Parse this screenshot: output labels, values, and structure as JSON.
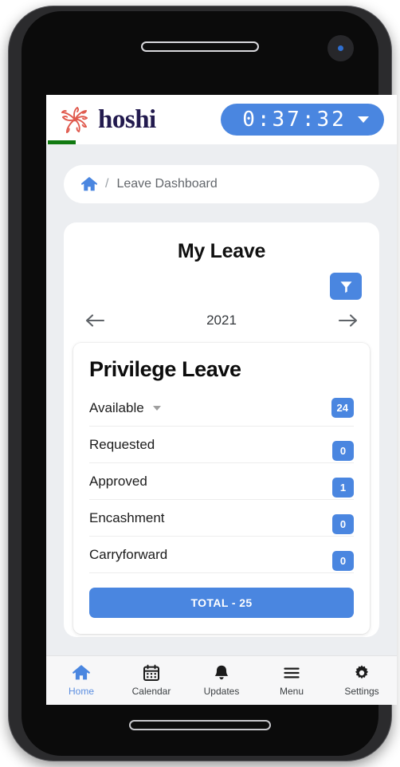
{
  "header": {
    "brand_name": "hoshi",
    "logo_icon": "hoshi-starburst-logo",
    "timer_value": "0:37:32",
    "timer_caret_icon": "chevron-down-icon",
    "accent_color": "#4a86e0",
    "progress_color": "#117a11",
    "brand_text_color": "#221a4e"
  },
  "breadcrumb": {
    "home_icon": "home-icon",
    "separator": "/",
    "current": "Leave Dashboard"
  },
  "leave_panel": {
    "title": "My Leave",
    "filter_icon": "filter-funnel-icon",
    "prev_icon": "arrow-left-icon",
    "next_icon": "arrow-right-icon",
    "year": "2021",
    "leave_type": "Privilege Leave",
    "rows": [
      {
        "label": "Available",
        "value": "24",
        "has_dropdown": true
      },
      {
        "label": "Requested",
        "value": "0",
        "has_dropdown": false
      },
      {
        "label": "Approved",
        "value": "1",
        "has_dropdown": false
      },
      {
        "label": "Encashment",
        "value": "0",
        "has_dropdown": false
      },
      {
        "label": "Carryforward",
        "value": "0",
        "has_dropdown": false
      }
    ],
    "total_label": "TOTAL - 25"
  },
  "bottom_nav": {
    "items": [
      {
        "label": "Home",
        "icon": "home-icon",
        "active": true
      },
      {
        "label": "Calendar",
        "icon": "calendar-icon",
        "active": false
      },
      {
        "label": "Updates",
        "icon": "bell-icon",
        "active": false
      },
      {
        "label": "Menu",
        "icon": "hamburger-menu-icon",
        "active": false
      },
      {
        "label": "Settings",
        "icon": "gear-icon",
        "active": false
      }
    ],
    "active_color": "#5b8ee0"
  }
}
